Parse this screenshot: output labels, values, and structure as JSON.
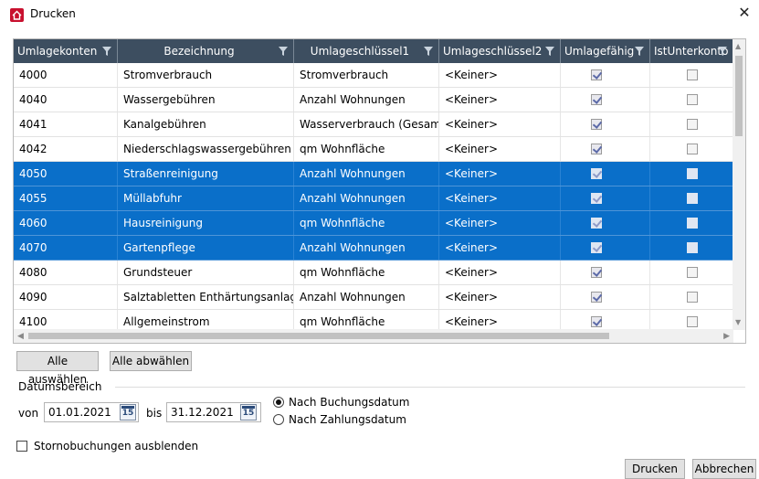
{
  "window": {
    "title": "Drucken",
    "close_icon": "close-icon",
    "app_icon": "home-icon"
  },
  "colors": {
    "header_bg": "#3d4e60",
    "selection": "#0a6fc9",
    "app_icon": "#c8102e"
  },
  "grid": {
    "columns": [
      "Umlagekonten",
      "Bezeichnung",
      "Umlageschlüssel1",
      "Umlageschlüssel2",
      "Umlagefähig",
      "IstUnterkonto"
    ],
    "rows": [
      {
        "konto": "4000",
        "bezeichnung": "Stromverbrauch",
        "schluessel1": "Stromverbrauch",
        "schluessel2": "<Keiner>",
        "umlagefaehig": true,
        "unterkonto": false,
        "selected": false
      },
      {
        "konto": "4040",
        "bezeichnung": "Wassergebühren",
        "schluessel1": "Anzahl Wohnungen",
        "schluessel2": "<Keiner>",
        "umlagefaehig": true,
        "unterkonto": false,
        "selected": false
      },
      {
        "konto": "4041",
        "bezeichnung": "Kanalgebühren",
        "schluessel1": "Wasserverbrauch (Gesamt)",
        "schluessel2": "<Keiner>",
        "umlagefaehig": true,
        "unterkonto": false,
        "selected": false
      },
      {
        "konto": "4042",
        "bezeichnung": "Niederschlagswassergebühren",
        "schluessel1": "qm Wohnfläche",
        "schluessel2": "<Keiner>",
        "umlagefaehig": true,
        "unterkonto": false,
        "selected": false
      },
      {
        "konto": "4050",
        "bezeichnung": "Straßenreinigung",
        "schluessel1": "Anzahl Wohnungen",
        "schluessel2": "<Keiner>",
        "umlagefaehig": true,
        "unterkonto": false,
        "selected": true
      },
      {
        "konto": "4055",
        "bezeichnung": "Müllabfuhr",
        "schluessel1": "Anzahl Wohnungen",
        "schluessel2": "<Keiner>",
        "umlagefaehig": true,
        "unterkonto": false,
        "selected": true
      },
      {
        "konto": "4060",
        "bezeichnung": "Hausreinigung",
        "schluessel1": "qm Wohnfläche",
        "schluessel2": "<Keiner>",
        "umlagefaehig": true,
        "unterkonto": false,
        "selected": true
      },
      {
        "konto": "4070",
        "bezeichnung": "Gartenpflege",
        "schluessel1": "Anzahl Wohnungen",
        "schluessel2": "<Keiner>",
        "umlagefaehig": true,
        "unterkonto": false,
        "selected": true
      },
      {
        "konto": "4080",
        "bezeichnung": "Grundsteuer",
        "schluessel1": "qm Wohnfläche",
        "schluessel2": "<Keiner>",
        "umlagefaehig": true,
        "unterkonto": false,
        "selected": false
      },
      {
        "konto": "4090",
        "bezeichnung": "Salztabletten Enthärtungsanlage",
        "schluessel1": "Anzahl Wohnungen",
        "schluessel2": "<Keiner>",
        "umlagefaehig": true,
        "unterkonto": false,
        "selected": false
      },
      {
        "konto": "4100",
        "bezeichnung": "Allgemeinstrom",
        "schluessel1": "qm Wohnfläche",
        "schluessel2": "<Keiner>",
        "umlagefaehig": true,
        "unterkonto": false,
        "selected": false
      }
    ]
  },
  "buttons": {
    "select_all": "Alle auswählen",
    "deselect_all": "Alle abwählen",
    "print": "Drucken",
    "cancel": "Abbrechen"
  },
  "date_range": {
    "group_label": "Datumsbereich",
    "from_label": "von",
    "from_value": "01.01.2021",
    "to_label": "bis",
    "to_value": "31.12.2021",
    "calendar_icon_text": "15",
    "options": [
      "Nach Buchungsdatum",
      "Nach Zahlungsdatum"
    ],
    "selected_option": "Nach Buchungsdatum"
  },
  "storno": {
    "label": "Stornobuchungen ausblenden",
    "checked": false
  }
}
